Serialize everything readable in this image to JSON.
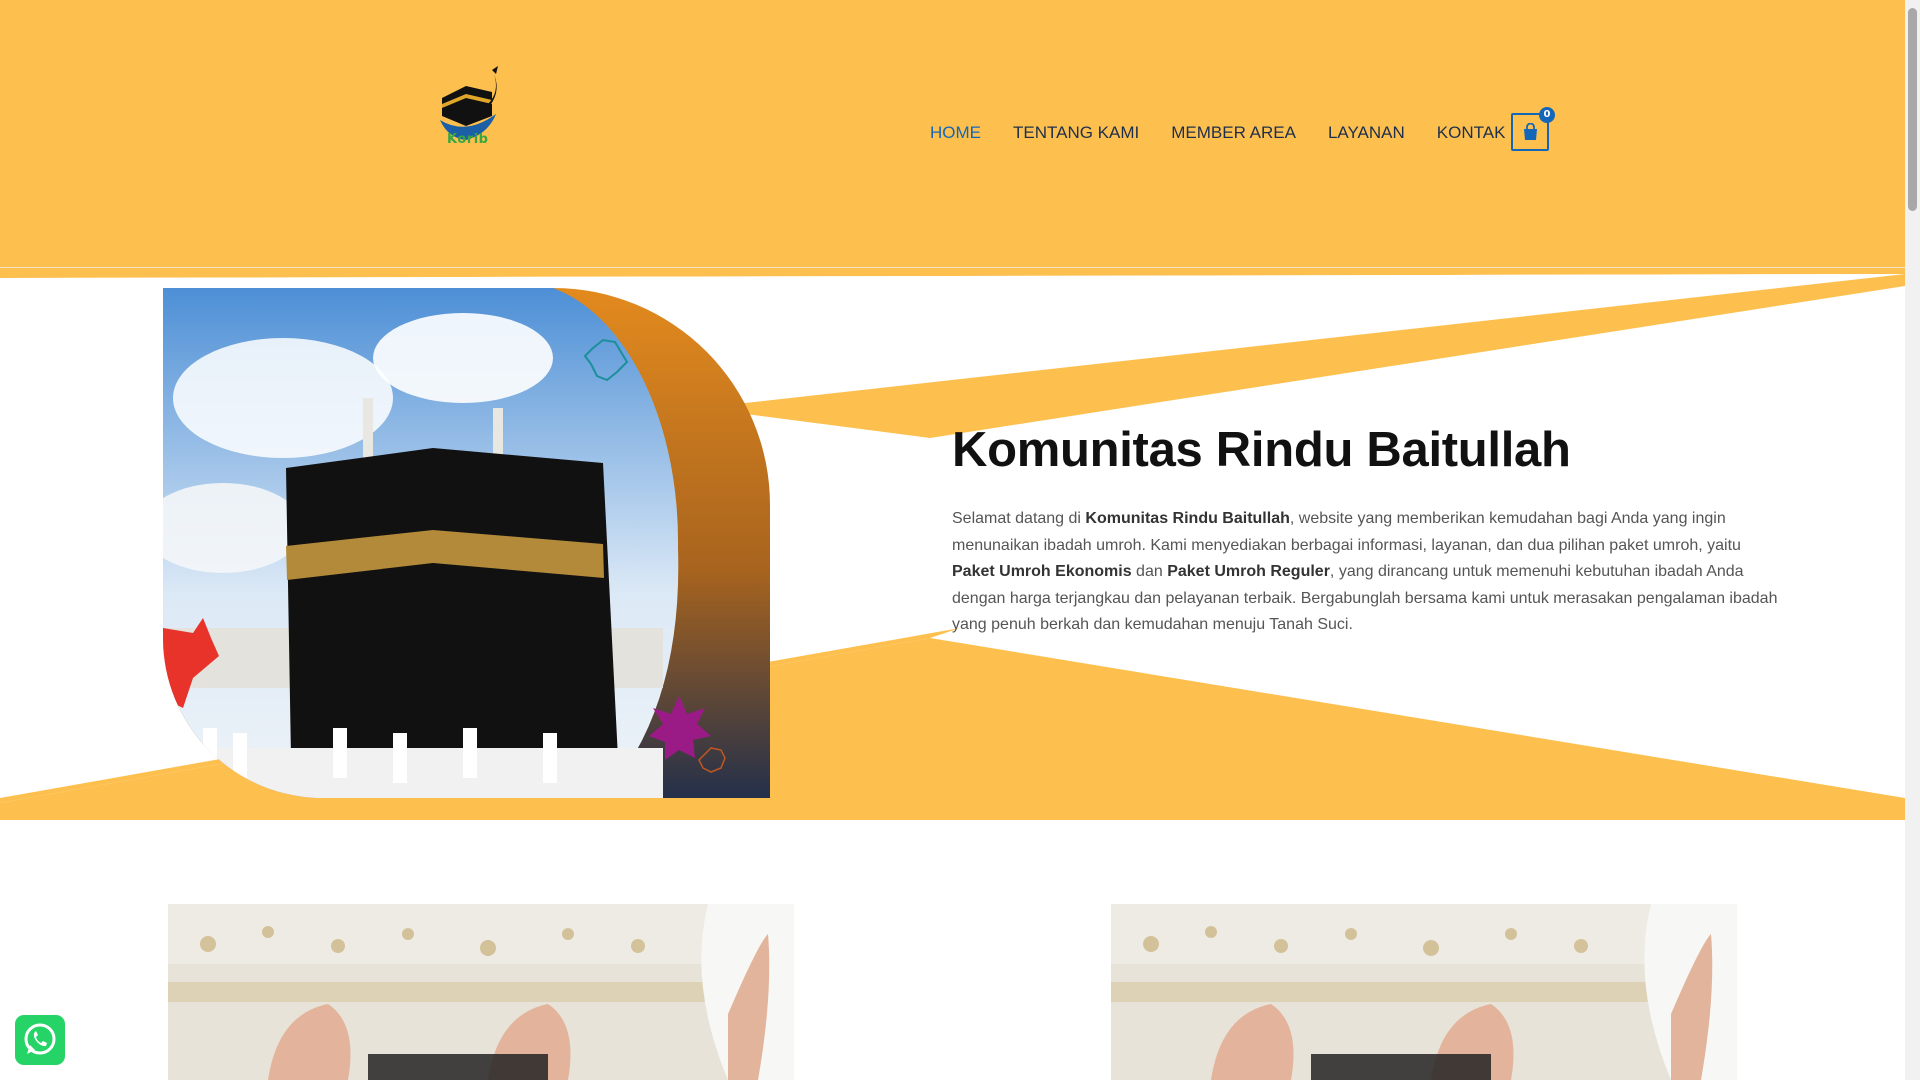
{
  "header": {
    "logo_text": "Korib",
    "nav": [
      {
        "label": "HOME",
        "active": true
      },
      {
        "label": "TENTANG KAMI",
        "active": false
      },
      {
        "label": "MEMBER AREA",
        "active": false
      },
      {
        "label": "LAYANAN",
        "active": false
      },
      {
        "label": "KONTAK",
        "active": false
      }
    ],
    "cart_count": "0",
    "cart_icon": "shopping-bag-icon"
  },
  "hero": {
    "title": "Komunitas Rindu Baitullah",
    "desc_1": "Selamat datang di ",
    "desc_bold_1": "Komunitas Rindu Baitullah",
    "desc_2": ", website yang memberikan kemudahan bagi Anda yang ingin menunaikan ibadah umroh. Kami menyediakan berbagai informasi, layanan, dan dua pilihan paket umroh, yaitu ",
    "desc_bold_2": "Paket Umroh Ekonomis",
    "desc_3": " dan ",
    "desc_bold_3": "Paket Umroh Reguler",
    "desc_4": ", yang dirancang untuk memenuhi kebutuhan ibadah Anda dengan harga terjangkau dan pelayanan terbaik. Bergabunglah bersama kami untuk merasakan pengalaman ibadah yang penuh berkah dan kemudahan menuju Tanah Suci."
  },
  "widgets": {
    "whatsapp_icon": "whatsapp-icon"
  },
  "colors": {
    "brand_yellow": "#fdc04f",
    "nav_text": "#1f2f4a",
    "accent_blue": "#1466b8",
    "whatsapp_green": "#25d366"
  }
}
